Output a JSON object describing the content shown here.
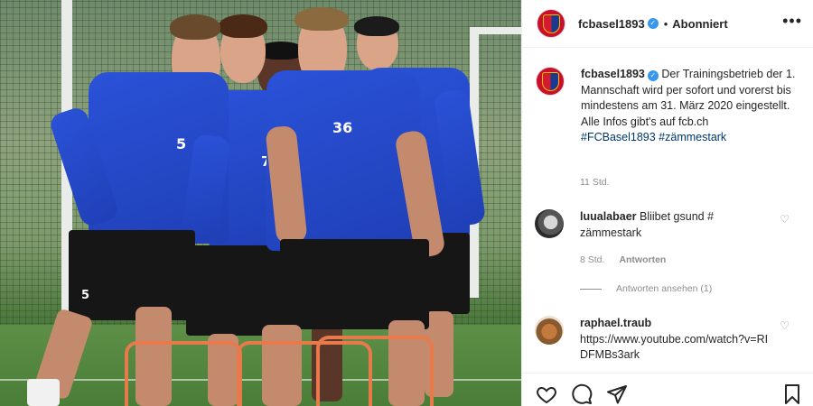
{
  "post": {
    "username": "fcbasel1893",
    "verified_icon": "verified-badge-icon",
    "separator": "•",
    "follow_status": "Abonniert",
    "more_icon": "more-horizontal-icon",
    "more_glyph": "•••"
  },
  "photo": {
    "player_numbers": [
      "5",
      "36",
      "7",
      "5"
    ]
  },
  "caption": {
    "username": "fcbasel1893",
    "text": "Der Trainingsbetrieb der 1. Mannschaft wird per sofort und vorerst bis mindestens am 31. März 2020 eingestellt. Alle Infos gibt's auf fcb.ch",
    "hashtags": "#FCBasel1893 #zämmestark",
    "time": "11 Std."
  },
  "comments": [
    {
      "username": "luualabaer",
      "text": "Bliibet gsund # zämmestark",
      "time": "8 Std.",
      "reply_label": "Antworten",
      "view_replies": "Antworten ansehen (1)",
      "heart_glyph": "♡"
    },
    {
      "username": "raphael.traub",
      "text": "https://www.youtube.com/watch?v=RIDFMBs3ark",
      "heart_glyph": "♡"
    }
  ],
  "actions": {
    "like_icon": "heart-icon",
    "comment_icon": "comment-icon",
    "share_icon": "share-icon",
    "save_icon": "bookmark-icon"
  },
  "colors": {
    "accent_blue": "#3897f0",
    "hashtag": "#00376b",
    "kit_blue": "#1f3fb6",
    "secondary_text": "#8e8e8e"
  }
}
